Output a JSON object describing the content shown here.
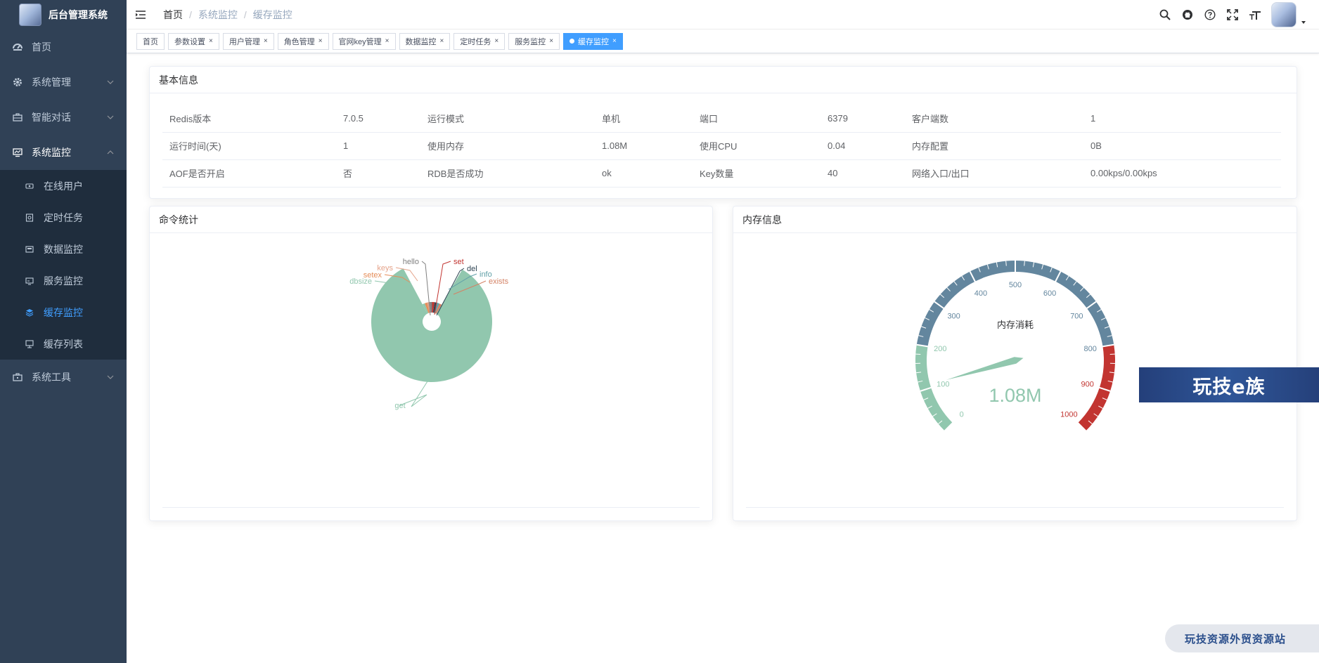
{
  "app": {
    "title": "后台管理系统"
  },
  "sidebar": {
    "items": [
      {
        "label": "首页",
        "icon": "dashboard-icon"
      },
      {
        "label": "系统管理",
        "icon": "gear-icon"
      },
      {
        "label": "智能对话",
        "icon": "briefcase-icon"
      },
      {
        "label": "系统监控",
        "icon": "monitor-icon"
      },
      {
        "label": "系统工具",
        "icon": "toolbox-icon"
      }
    ],
    "submenu": [
      {
        "label": "在线用户",
        "icon": "online-icon"
      },
      {
        "label": "定时任务",
        "icon": "job-icon"
      },
      {
        "label": "数据监控",
        "icon": "druid-icon"
      },
      {
        "label": "服务监控",
        "icon": "server-icon"
      },
      {
        "label": "缓存监控",
        "icon": "redis-icon"
      },
      {
        "label": "缓存列表",
        "icon": "list-icon"
      }
    ]
  },
  "breadcrumb": [
    "首页",
    "系统监控",
    "缓存监控"
  ],
  "tags": [
    {
      "label": "首页"
    },
    {
      "label": "参数设置"
    },
    {
      "label": "用户管理"
    },
    {
      "label": "角色管理"
    },
    {
      "label": "官网key管理"
    },
    {
      "label": "数据监控"
    },
    {
      "label": "定时任务"
    },
    {
      "label": "服务监控"
    },
    {
      "label": "缓存监控"
    }
  ],
  "tag_close_symbol": "×",
  "basic_info": {
    "title": "基本信息",
    "rows": [
      [
        "Redis版本",
        "7.0.5",
        "运行模式",
        "单机",
        "端口",
        "6379",
        "客户端数",
        "1"
      ],
      [
        "运行时间(天)",
        "1",
        "使用内存",
        "1.08M",
        "使用CPU",
        "0.04",
        "内存配置",
        "0B"
      ],
      [
        "AOF是否开启",
        "否",
        "RDB是否成功",
        "ok",
        "Key数量",
        "40",
        "网络入口/出口",
        "0.00kps/0.00kps"
      ]
    ]
  },
  "command_stats": {
    "title": "命令统计"
  },
  "memory_info": {
    "title": "内存信息"
  },
  "chart_data": [
    {
      "type": "pie",
      "variant": "rose-radius",
      "title": "",
      "categories": [
        "get",
        "dbsize",
        "setex",
        "keys",
        "hello",
        "set",
        "del",
        "info",
        "exists"
      ],
      "values": [
        93,
        1,
        1,
        1,
        1,
        1,
        1,
        1,
        1
      ],
      "colors": [
        "#91c7ae",
        "#91c7ae",
        "#e58e5a",
        "#e5a38a",
        "#7f7f7f",
        "#c23531",
        "#2f4554",
        "#61a0a8",
        "#d48265"
      ]
    },
    {
      "type": "gauge",
      "title": "内存消耗",
      "value": 108,
      "display_value": "1.08M",
      "min": 0,
      "max": 1000,
      "tick_labels": [
        "0",
        "100",
        "200",
        "300",
        "400",
        "500",
        "600",
        "700",
        "800",
        "900",
        "1000"
      ],
      "color_bands": [
        {
          "to": 0.2,
          "color": "#91c7ae"
        },
        {
          "to": 0.8,
          "color": "#63869e"
        },
        {
          "to": 1.0,
          "color": "#c23531"
        }
      ]
    }
  ],
  "watermarks": {
    "box_text": "玩技e族",
    "pill_text": "玩技资源外贸资源站"
  }
}
